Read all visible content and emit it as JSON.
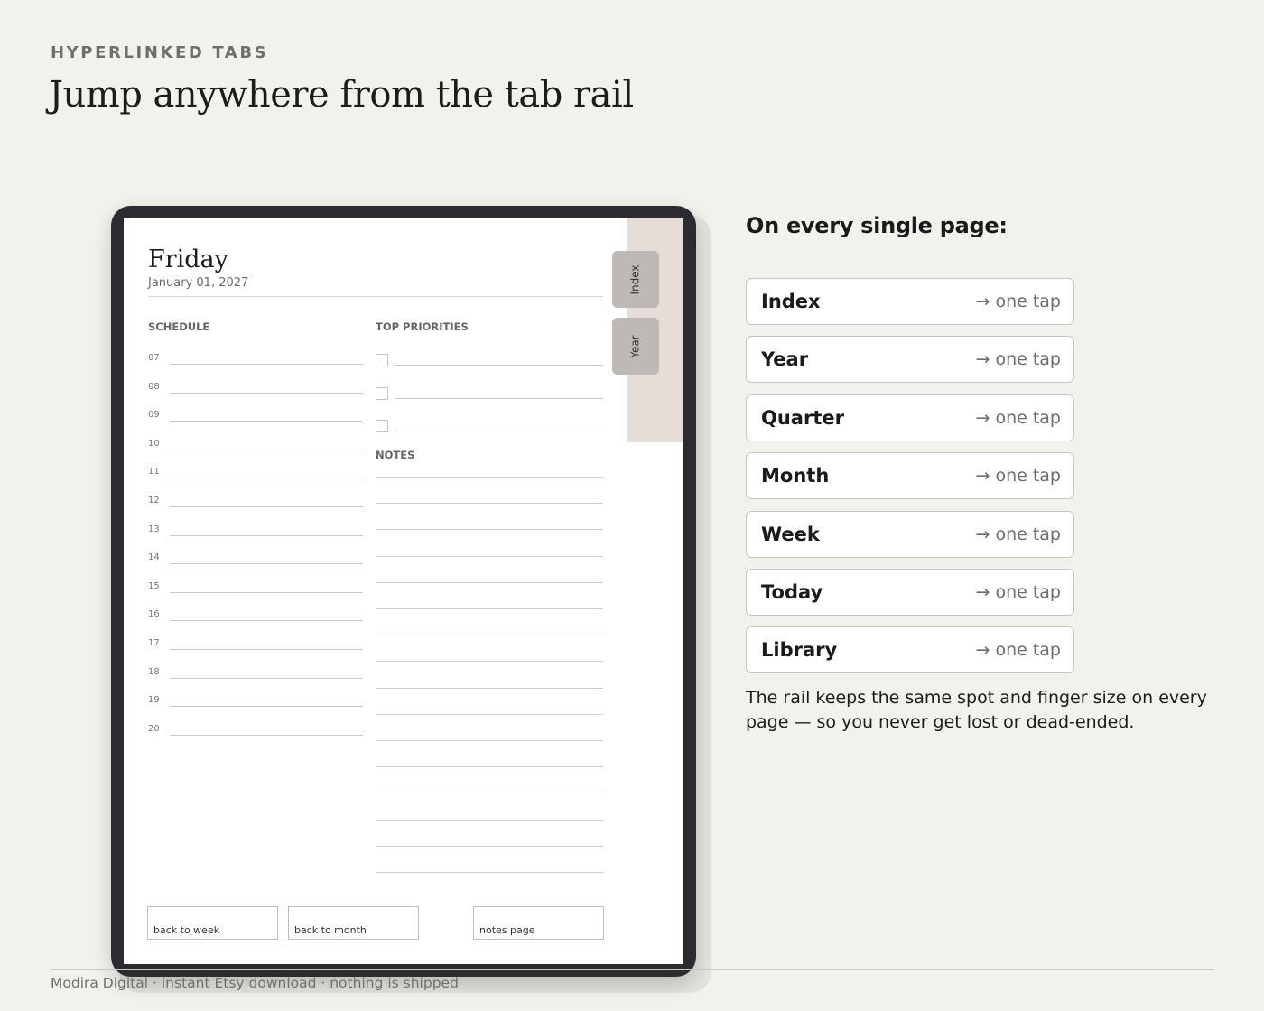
{
  "header": {
    "eyebrow": "HYPERLINKED TABS",
    "title": "Jump anywhere from the tab rail"
  },
  "tablet": {
    "day": "Friday",
    "date": "January 01, 2027",
    "rail_tabs": [
      "Index",
      "Year"
    ],
    "schedule_label": "SCHEDULE",
    "hours": [
      "07",
      "08",
      "09",
      "10",
      "11",
      "12",
      "13",
      "14",
      "15",
      "16",
      "17",
      "18",
      "19",
      "20"
    ],
    "priorities_label": "TOP PRIORITIES",
    "priority_count": 3,
    "notes_label": "NOTES",
    "nav": [
      "back to week",
      "back to month",
      "notes page"
    ]
  },
  "panel": {
    "heading": "On every single page:",
    "targets": [
      "Index",
      "Year",
      "Quarter",
      "Month",
      "Week",
      "Today",
      "Library"
    ],
    "tap_label": "→ one tap",
    "description": "The rail keeps the same spot and finger size on every page — so you never get lost or dead-ended."
  },
  "footer": {
    "text": "Modira Digital · instant Etsy download · nothing is shipped"
  },
  "colors": {
    "background": "#f3f1ec",
    "tablet_bezel": "#2c2c30",
    "rail": "#e5ddd6",
    "rail_tab": "#bcb9b6"
  }
}
